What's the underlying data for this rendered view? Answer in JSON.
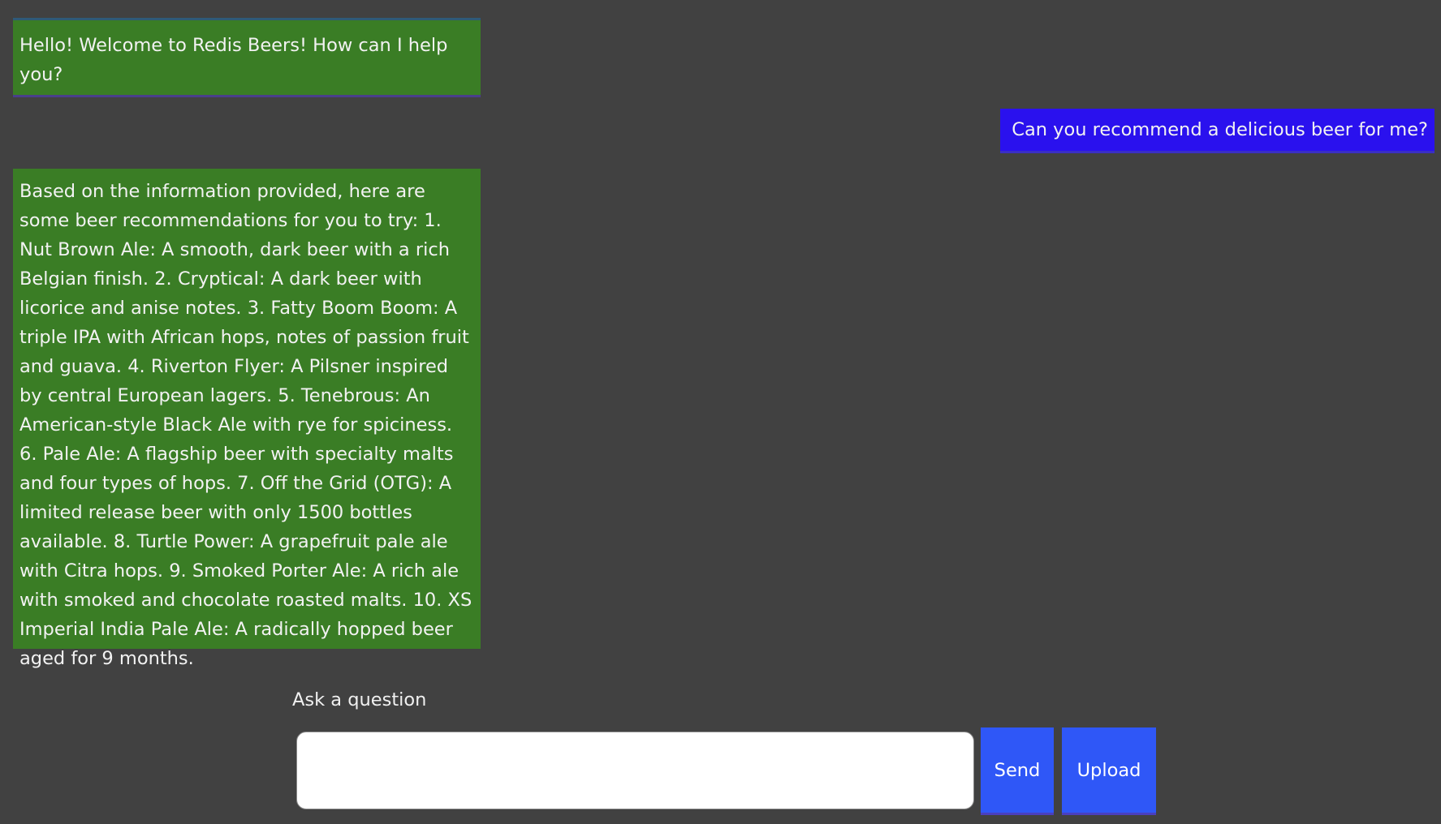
{
  "messages": [
    {
      "role": "bot",
      "text": "Hello! Welcome to Redis Beers! How can I help you?"
    },
    {
      "role": "user",
      "text": "Can you recommend a delicious beer for me?"
    },
    {
      "role": "bot",
      "text": "Based on the information provided, here are some beer recommendations for you to try: 1. Nut Brown Ale: A smooth, dark beer with a rich Belgian finish. 2. Cryptical: A dark beer with licorice and anise notes. 3. Fatty Boom Boom: A triple IPA with African hops, notes of passion fruit and guava. 4. Riverton Flyer: A Pilsner inspired by central European lagers. 5. Tenebrous: An American-style Black Ale with rye for spiciness. 6. Pale Ale: A flagship beer with specialty malts and four types of hops. 7. Off the Grid (OTG): A limited release beer with only 1500 bottles available. 8. Turtle Power: A grapefruit pale ale with Citra hops. 9. Smoked Porter Ale: A rich ale with smoked and chocolate roasted malts. 10. XS Imperial India Pale Ale: A radically hopped beer aged for 9 months."
    }
  ],
  "composer": {
    "label": "Ask a question",
    "input_value": "",
    "send_label": "Send",
    "upload_label": "Upload"
  },
  "colors": {
    "background": "#414141",
    "bot_bubble": "#3a7d25",
    "user_bubble": "#2a11ee",
    "button": "#2f57f7"
  }
}
